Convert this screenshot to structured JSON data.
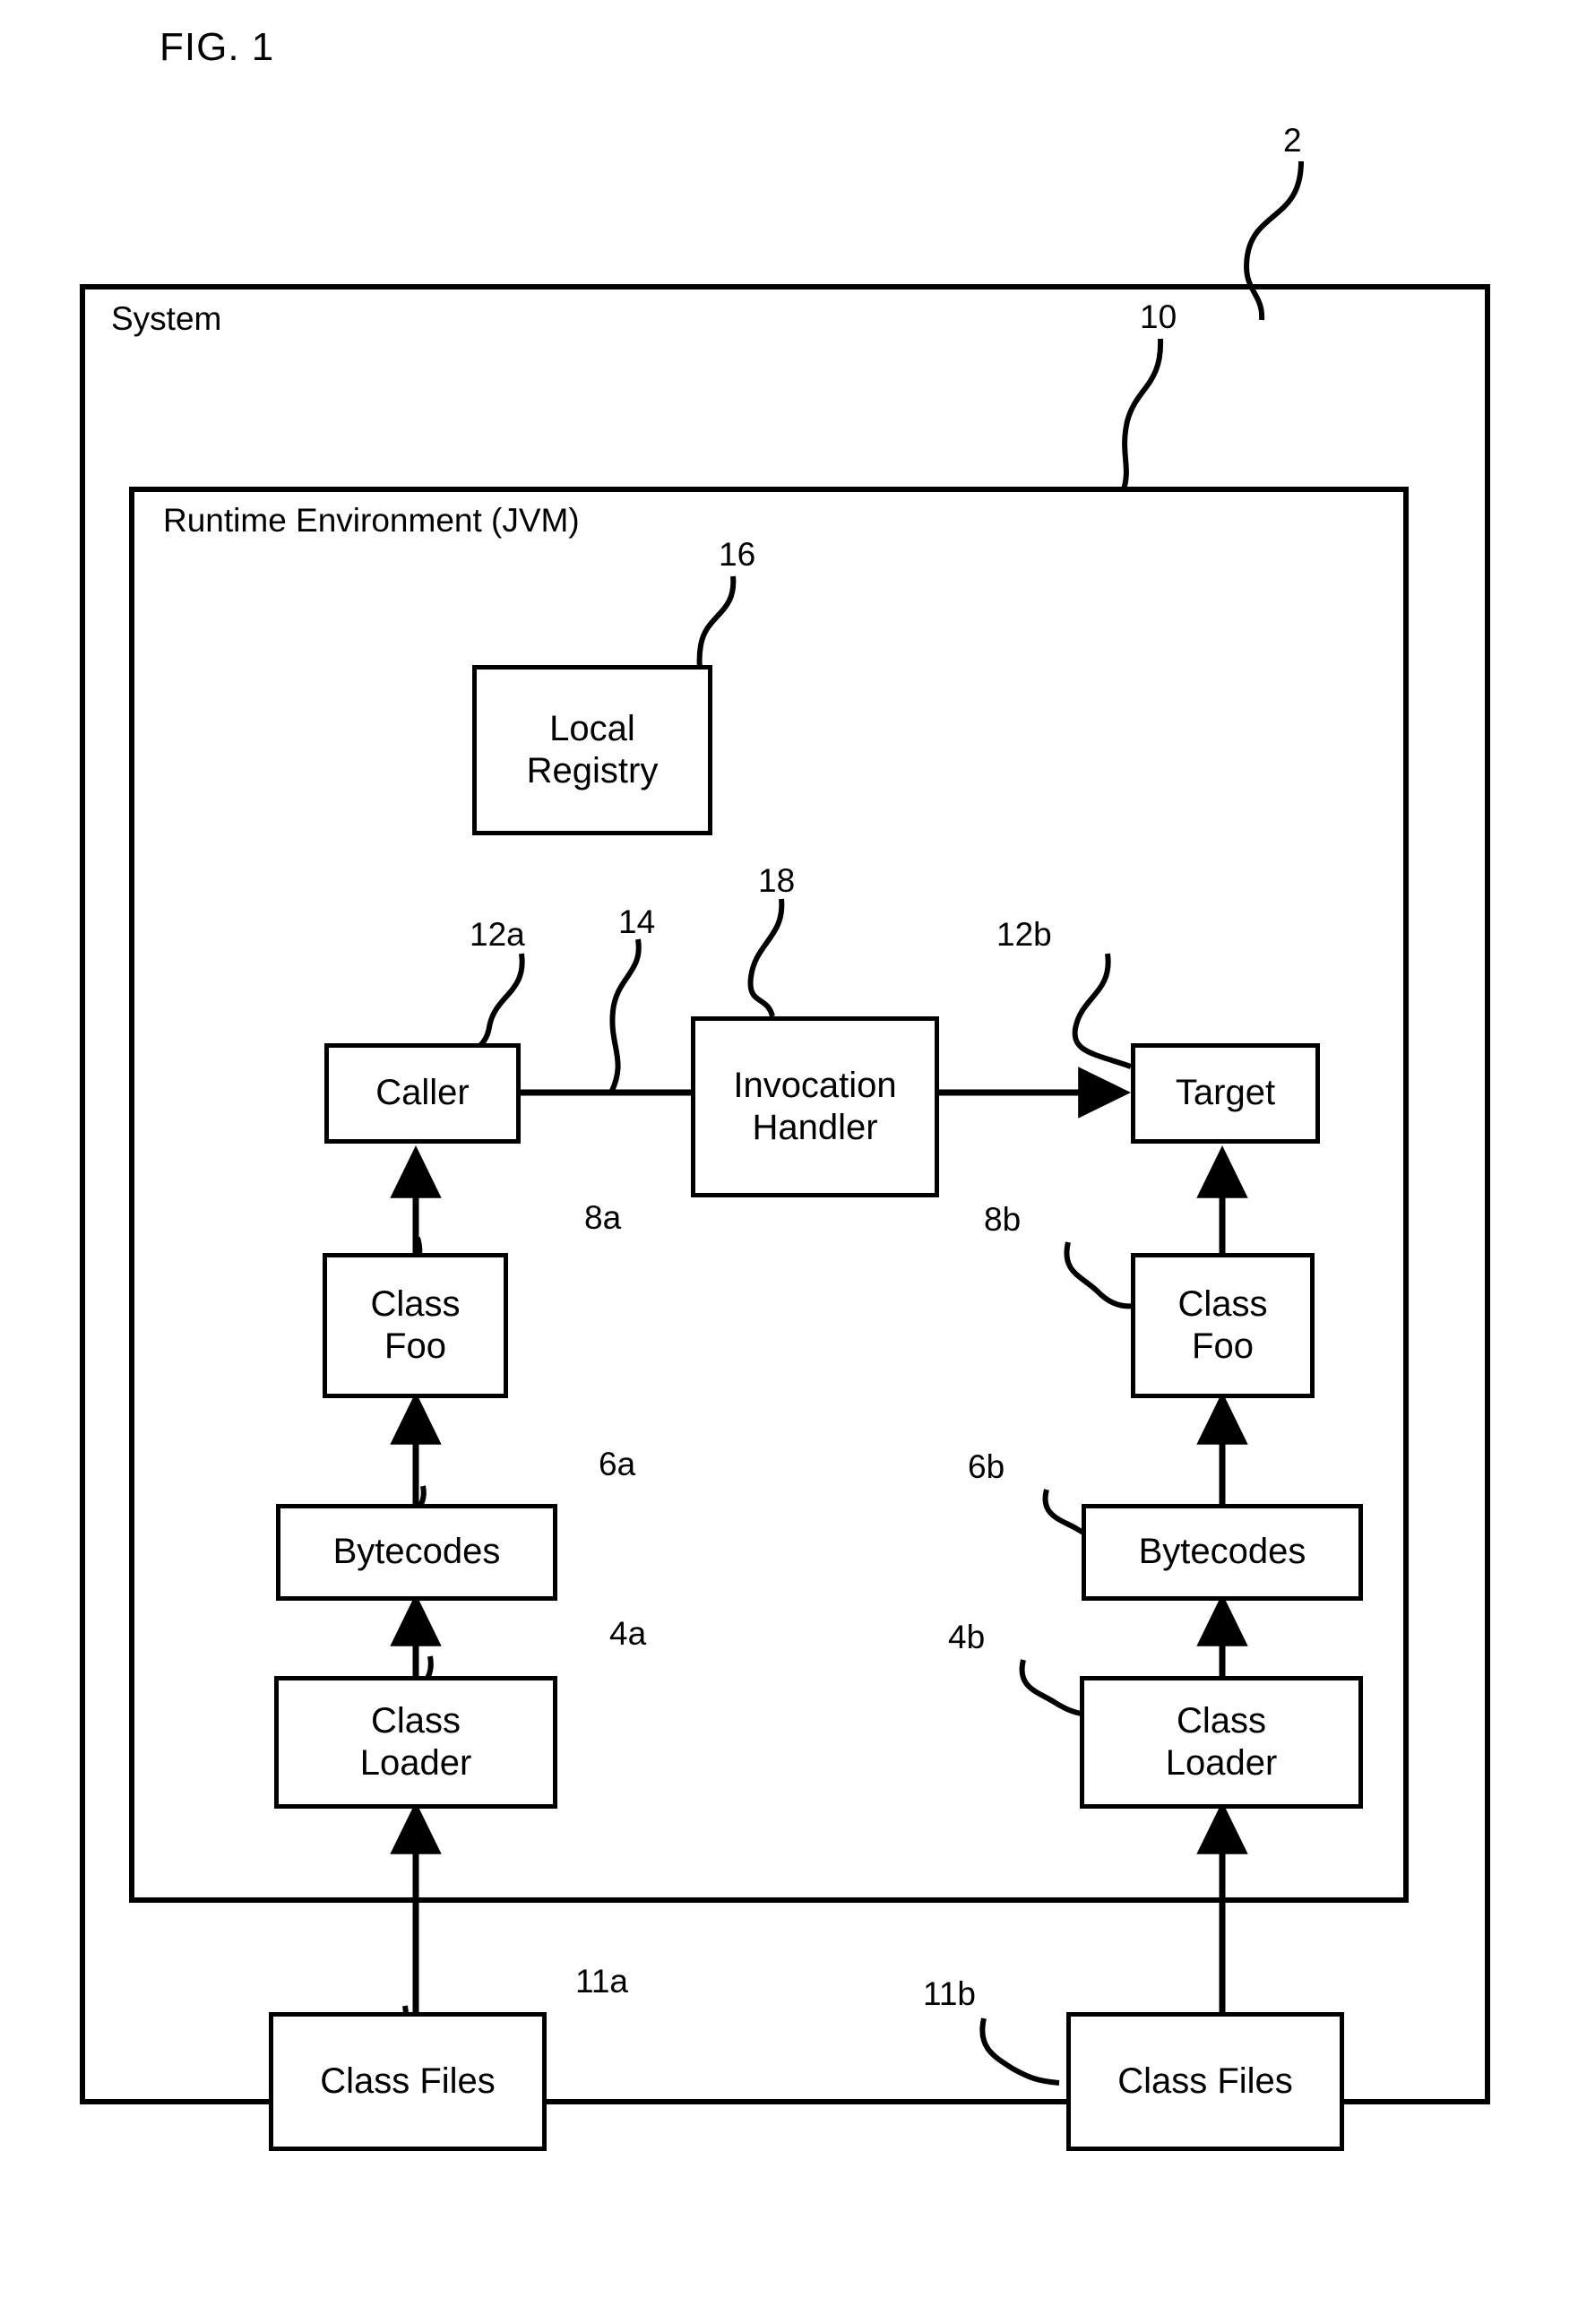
{
  "figure": {
    "title": "FIG. 1"
  },
  "containers": [
    {
      "key": "system",
      "label": "System",
      "ref": "2"
    },
    {
      "key": "jvm",
      "label": "Runtime Environment (JVM)",
      "ref": "10"
    }
  ],
  "boxes": [
    {
      "key": "local_registry",
      "label": "Local\nRegistry",
      "ref": "16"
    },
    {
      "key": "caller",
      "label": "Caller",
      "ref": "12a"
    },
    {
      "key": "invocation",
      "label": "Invocation\nHandler",
      "ref": "18"
    },
    {
      "key": "target",
      "label": "Target",
      "ref": "12b"
    },
    {
      "key": "class_foo_a",
      "label": "Class\nFoo",
      "ref": "8a"
    },
    {
      "key": "class_foo_b",
      "label": "Class\nFoo",
      "ref": "8b"
    },
    {
      "key": "bytecodes_a",
      "label": "Bytecodes",
      "ref": "6a"
    },
    {
      "key": "bytecodes_b",
      "label": "Bytecodes",
      "ref": "6b"
    },
    {
      "key": "class_loader_a",
      "label": "Class\nLoader",
      "ref": "4a"
    },
    {
      "key": "class_loader_b",
      "label": "Class\nLoader",
      "ref": "4b"
    },
    {
      "key": "class_files_a",
      "label": "Class Files",
      "ref": "11a"
    },
    {
      "key": "class_files_b",
      "label": "Class Files",
      "ref": "11b"
    }
  ],
  "connectors": [
    {
      "key": "caller_to_invocation",
      "ref": "14"
    }
  ],
  "colors": {
    "ink": "#000000",
    "paper": "#ffffff"
  }
}
